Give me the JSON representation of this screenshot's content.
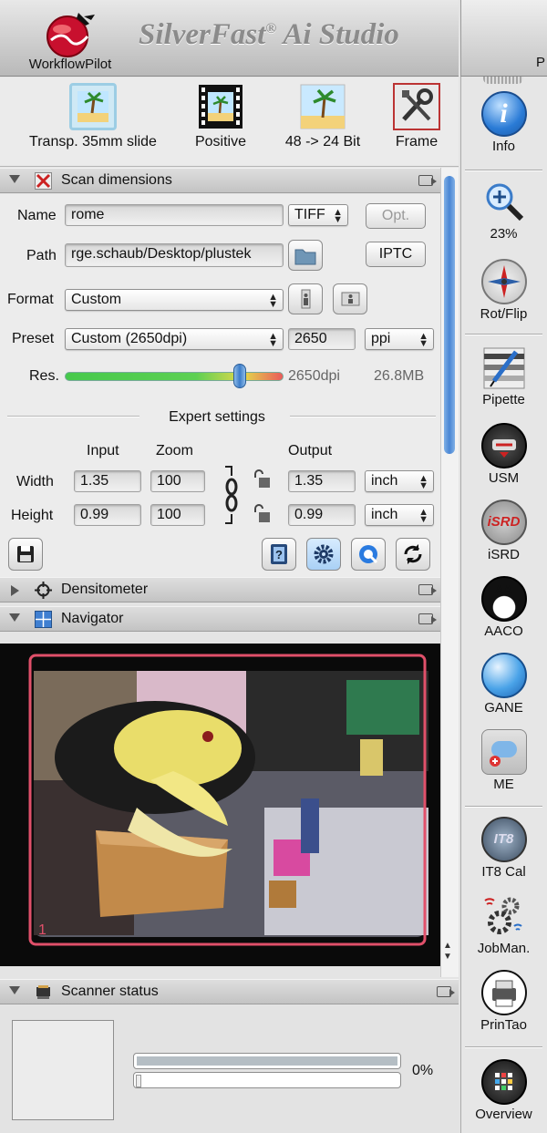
{
  "header": {
    "workflow_label": "WorkflowPilot",
    "title": "SilverFast",
    "title_reg": "®",
    "title_rest": " Ai Studio",
    "clipped_letter": "P"
  },
  "toolbar": {
    "items": [
      {
        "label": "Transp. 35mm slide",
        "icon": "slide-icon"
      },
      {
        "label": "Positive",
        "icon": "film-strip-icon"
      },
      {
        "label": "48 -> 24 Bit",
        "icon": "palm-picture-icon"
      },
      {
        "label": "Frame",
        "icon": "tools-icon"
      }
    ]
  },
  "scan_dimensions": {
    "title": "Scan dimensions",
    "name_label": "Name",
    "name_value": "rome",
    "format_type": "TIFF",
    "opt_label": "Opt.",
    "path_label": "Path",
    "path_value": "rge.schaub/Desktop/plustek",
    "iptc_label": "IPTC",
    "format_label": "Format",
    "format_value": "Custom",
    "preset_label": "Preset",
    "preset_value": "Custom (2650dpi)",
    "preset_dpi": "2650",
    "preset_unit": "ppi",
    "res_label": "Res.",
    "res_value": "2650dpi",
    "res_size": "26.8MB",
    "res_slider_fraction": 0.8,
    "expert_label": "Expert settings",
    "col_input": "Input",
    "col_zoom": "Zoom",
    "col_output": "Output",
    "width_label": "Width",
    "width_input": "1.35",
    "width_zoom": "100",
    "width_output": "1.35",
    "width_unit": "inch",
    "height_label": "Height",
    "height_input": "0.99",
    "height_zoom": "100",
    "height_output": "0.99",
    "height_unit": "inch"
  },
  "densitometer": {
    "title": "Densitometer"
  },
  "navigator": {
    "title": "Navigator",
    "frame_number": "1"
  },
  "scanner_status": {
    "title": "Scanner status",
    "progress_text": "0%",
    "progress": 0
  },
  "right_tools": [
    {
      "label": "Info",
      "icon": "info-icon"
    },
    {
      "label": "23%",
      "icon": "zoom-icon"
    },
    {
      "label": "Rot/Flip",
      "icon": "compass-icon"
    },
    {
      "label": "Pipette",
      "icon": "pipette-icon"
    },
    {
      "label": "USM",
      "icon": "usm-icon"
    },
    {
      "label": "iSRD",
      "icon": "isrd-icon"
    },
    {
      "label": "AACO",
      "icon": "aaco-icon"
    },
    {
      "label": "GANE",
      "icon": "gane-icon"
    },
    {
      "label": "ME",
      "icon": "me-icon"
    },
    {
      "label": "IT8 Cal",
      "icon": "it8-icon"
    },
    {
      "label": "JobMan.",
      "icon": "jobman-icon"
    },
    {
      "label": "PrinTao",
      "icon": "printao-icon"
    },
    {
      "label": "Overview",
      "icon": "overview-icon"
    }
  ]
}
